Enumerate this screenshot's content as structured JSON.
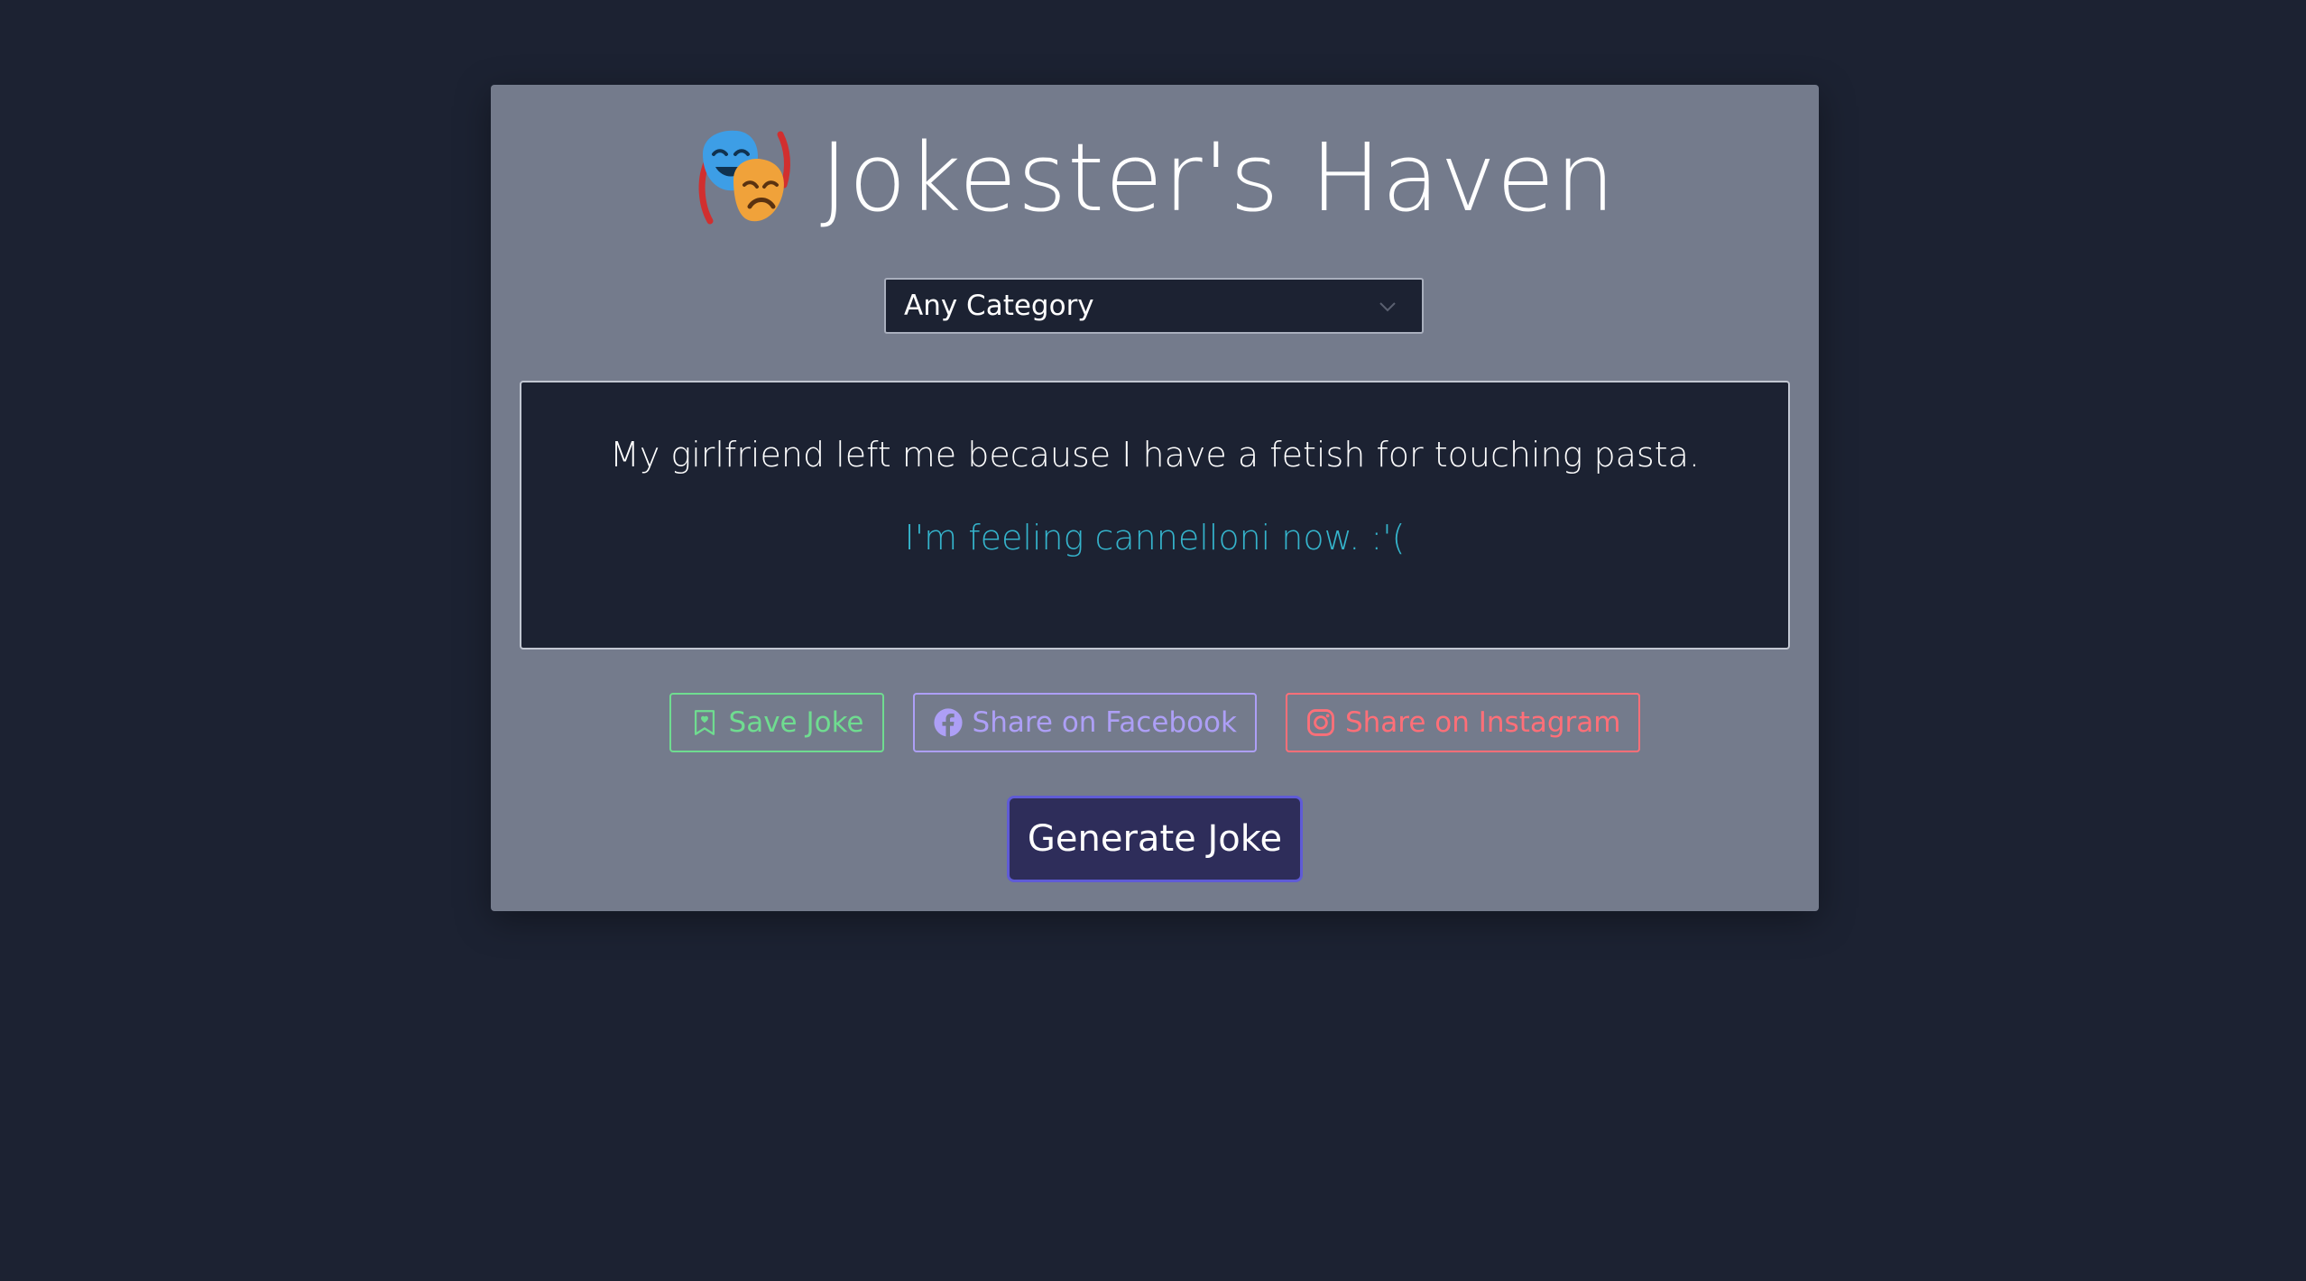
{
  "app": {
    "title": "Jokester's Haven",
    "title_icon": "performing-arts-masks-icon"
  },
  "category_select": {
    "selected": "Any Category",
    "icon": "chevron-down-icon"
  },
  "joke": {
    "setup": "My girlfriend left me because I have a fetish for touching pasta.",
    "delivery": "I'm feeling cannelloni now. :'("
  },
  "actions": {
    "save_label": "Save Joke",
    "save_icon": "bookmark-heart-icon",
    "facebook_label": "Share on Facebook",
    "facebook_icon": "facebook-icon",
    "instagram_label": "Share on Instagram",
    "instagram_icon": "instagram-icon"
  },
  "generate_label": "Generate Joke",
  "colors": {
    "background": "#1c2232",
    "card": "#747b8c",
    "delivery_text": "#35b4cc",
    "save": "#6fdc90",
    "facebook": "#ad9ff6",
    "instagram": "#ff6f78",
    "generate_bg": "#2e2d5a",
    "generate_border": "#5f5bd6"
  }
}
